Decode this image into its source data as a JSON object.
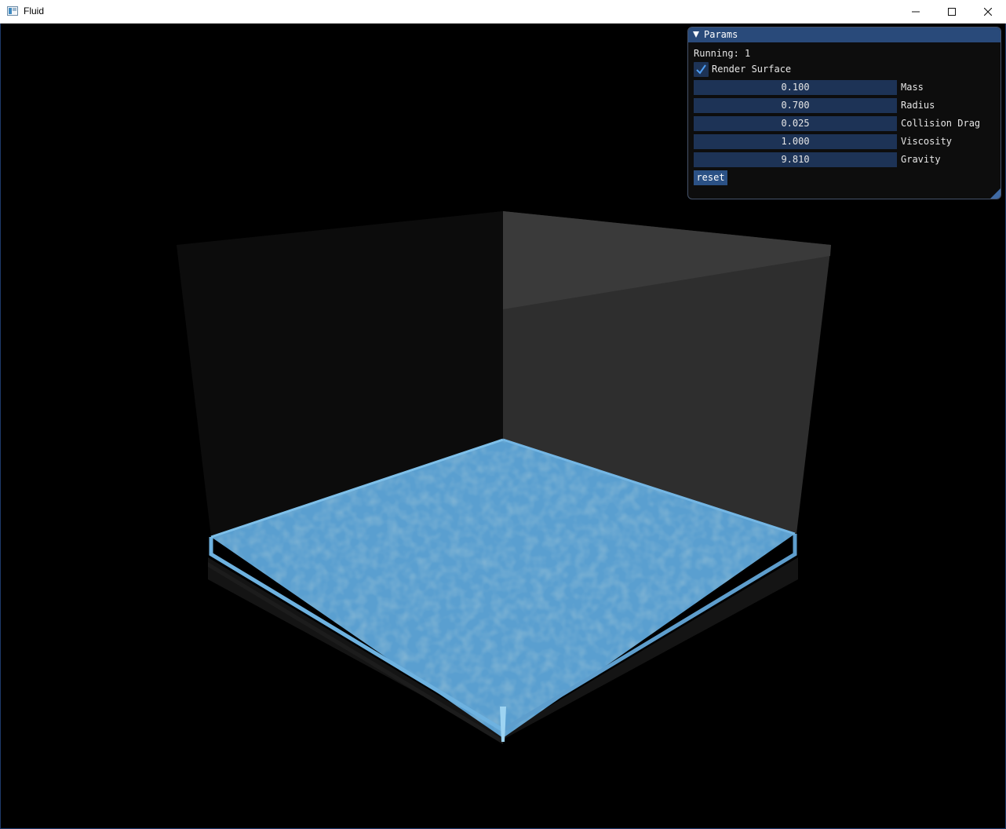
{
  "window": {
    "title": "Fluid",
    "buttons": {
      "minimize": "minimize-icon",
      "maximize": "maximize-icon",
      "close": "close-icon"
    }
  },
  "params_panel": {
    "title": "Params",
    "running_label": "Running: 1",
    "render_surface": {
      "label": "Render Surface",
      "checked": true
    },
    "sliders": [
      {
        "label": "Mass",
        "value": "0.100"
      },
      {
        "label": "Radius",
        "value": "0.700"
      },
      {
        "label": "Collision Drag",
        "value": "0.025"
      },
      {
        "label": "Viscosity",
        "value": "1.000"
      },
      {
        "label": "Gravity",
        "value": "9.810"
      }
    ],
    "reset_label": "reset"
  },
  "colors": {
    "panel_header": "#294a7a",
    "slider_bg": "#1d3356",
    "button_bg": "#2b5185",
    "fluid": "#5a9fd0",
    "fluid_edge": "#7ec0ea",
    "back_wall": "#2f2f2f",
    "left_wall": "#0d0d0d"
  }
}
